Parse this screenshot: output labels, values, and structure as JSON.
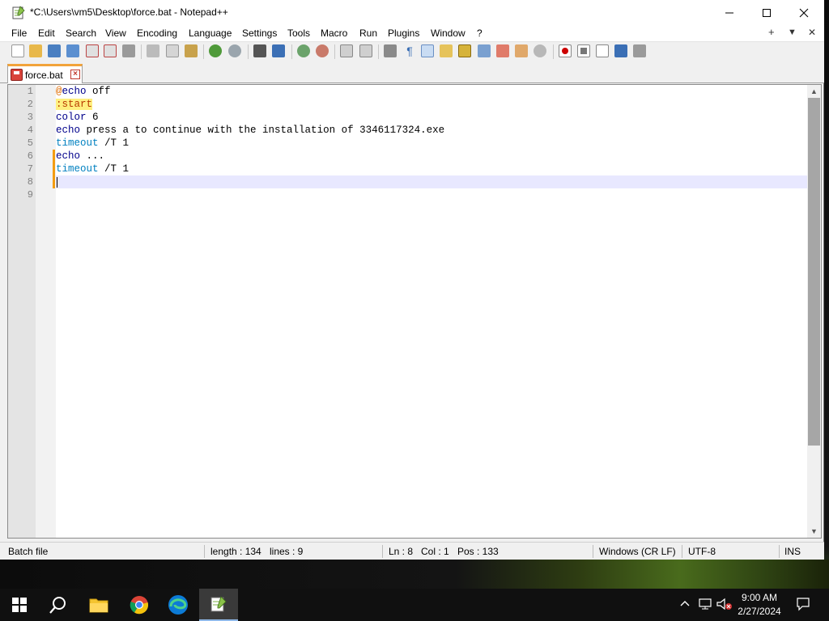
{
  "window": {
    "title": "*C:\\Users\\vm5\\Desktop\\force.bat - Notepad++"
  },
  "menu": {
    "items": [
      "File",
      "Edit",
      "Search",
      "View",
      "Encoding",
      "Language",
      "Settings",
      "Tools",
      "Macro",
      "Run",
      "Plugins",
      "Window",
      "?"
    ],
    "right": {
      "plus": "+",
      "dropdown": "▼",
      "close": "✕"
    }
  },
  "tab": {
    "title": "force.bat"
  },
  "editor": {
    "line_numbers": [
      "1",
      "2",
      "3",
      "4",
      "5",
      "6",
      "7",
      "8",
      "9"
    ],
    "lines": [
      {
        "num": "1",
        "parts": [
          {
            "t": "@",
            "c": "at"
          },
          {
            "t": "echo",
            "c": "kw"
          },
          {
            "t": " off",
            "c": ""
          }
        ]
      },
      {
        "num": "2",
        "parts": [
          {
            "t": ":start",
            "c": "lbl"
          }
        ]
      },
      {
        "num": "3",
        "parts": [
          {
            "t": "color",
            "c": "kw"
          },
          {
            "t": " 6",
            "c": ""
          }
        ]
      },
      {
        "num": "4",
        "parts": [
          {
            "t": "echo",
            "c": "kw"
          },
          {
            "t": " press a to continue with the installation of 3346117324.exe",
            "c": ""
          }
        ]
      },
      {
        "num": "5",
        "parts": [
          {
            "t": "timeout",
            "c": "tm"
          },
          {
            "t": " /T 1",
            "c": ""
          }
        ]
      },
      {
        "num": "6",
        "parts": [
          {
            "t": "echo",
            "c": "kw"
          },
          {
            "t": " ...",
            "c": ""
          }
        ]
      },
      {
        "num": "7",
        "parts": [
          {
            "t": "timeout",
            "c": "tm"
          },
          {
            "t": " /T 1",
            "c": ""
          }
        ]
      },
      {
        "num": "8",
        "parts": []
      },
      {
        "num": "9",
        "parts": []
      }
    ],
    "current_line": 8
  },
  "status": {
    "file_type": "Batch file",
    "length": "length : 134",
    "lines": "lines : 9",
    "ln": "Ln : 8",
    "col": "Col : 1",
    "pos": "Pos : 133",
    "eol": "Windows (CR LF)",
    "encoding": "UTF-8",
    "mode": "INS"
  },
  "taskbar": {
    "time": "9:00 AM",
    "date": "2/27/2024"
  }
}
